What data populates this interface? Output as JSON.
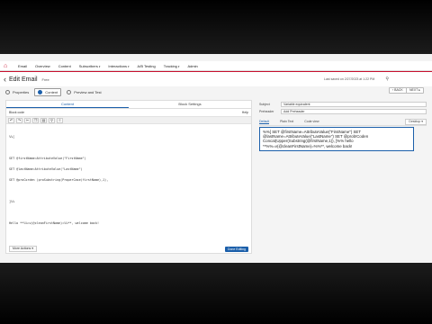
{
  "nav": {
    "logo_icon": "brand-house-icon",
    "items": [
      {
        "label": "Email",
        "caret": ""
      },
      {
        "label": "Overview",
        "caret": ""
      },
      {
        "label": "Content",
        "caret": ""
      },
      {
        "label": "Subscribers",
        "caret": "▾"
      },
      {
        "label": "Interactions",
        "caret": "▾"
      },
      {
        "label": "A/B Testing",
        "caret": ""
      },
      {
        "label": "Tracking",
        "caret": "▾"
      },
      {
        "label": "Admin",
        "caret": ""
      }
    ]
  },
  "header": {
    "back_glyph": "‹",
    "title": "Edit Email",
    "subtitle": "Free",
    "saved_text": "Last saved on 2/27/2023 at 1:22 PM",
    "back_btn": "‹ BACK",
    "next_btn": "NEXT ▸"
  },
  "steps": [
    {
      "label": "Properties"
    },
    {
      "label": "Content"
    },
    {
      "label": "Preview and Test"
    }
  ],
  "editor": {
    "tab_content": "Content",
    "tab_block": "Block Settings",
    "row_left": "Block code",
    "row_right": "Help",
    "code_lines": [
      "%%[",
      "",
      "SET @firstName=AttributeValue(\"FirstName\")",
      "SET @lastName=AttributeValue(\"LastName\")",
      "SET @proCorden (proSubstring(ProperCase(firstName),1),",
      "",
      "]%%",
      "",
      "Hello **%%=v(@cleanFirstName)=%%**, welcome back!"
    ],
    "more_btn": "More Actions ▾",
    "build_btn": "Done Editing"
  },
  "preview": {
    "subject_label": "Subject",
    "subject_value": "Variable equivalent",
    "preheader_label": "Preheader",
    "preheader_value": "Add Preheader",
    "tab_default": "Default",
    "tab_plain": "Plain Text",
    "tab_code": "Code view",
    "desktop": "Desktop ▾",
    "body": "%%[ SET @firstName=AttributeValue(\"FirstName\") SET\n@lastName=AttributeValue(\"LastName\") SET @prob!Coden\nConcat(Upper(Substring(@firstName,1)), ]%% hello\n**%%=v(@cleanFirstName)=%%**, welcome back!"
  }
}
